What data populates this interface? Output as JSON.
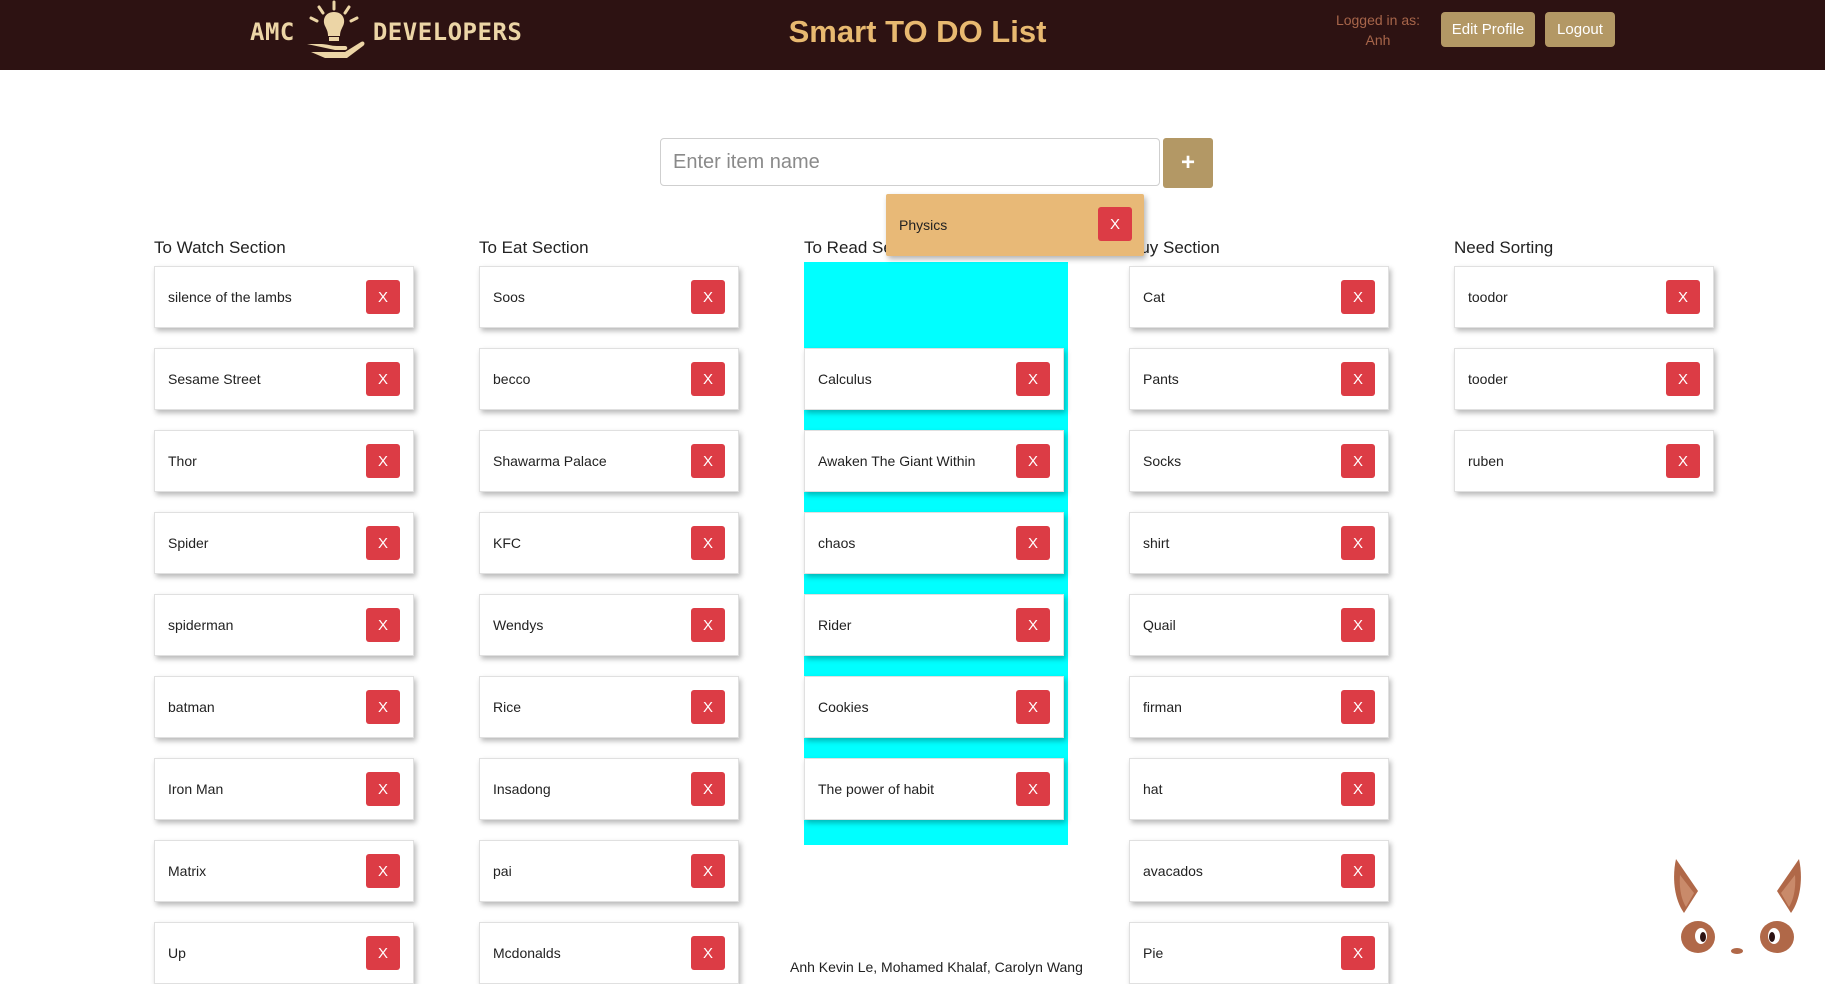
{
  "header": {
    "logo_left": "AMC",
    "logo_right": "DEVELOPERS",
    "title": "Smart TO DO List",
    "logged_in_label": "Logged in as:",
    "user": "Anh",
    "edit_profile": "Edit Profile",
    "logout": "Logout"
  },
  "add_item": {
    "placeholder": "Enter item name",
    "button": "+"
  },
  "dragging_item": {
    "label": "Physics",
    "delete": "X"
  },
  "delete_label": "X",
  "sections": [
    {
      "title": "To Watch Section",
      "items": [
        "silence of the lambs",
        "Sesame Street",
        "Thor",
        "Spider",
        "spiderman",
        "batman",
        "Iron Man",
        "Matrix",
        "Up"
      ]
    },
    {
      "title": "To Eat Section",
      "items": [
        "Soos",
        "becco",
        "Shawarma Palace",
        "KFC",
        "Wendys",
        "Rice",
        "Insadong",
        "pai",
        "Mcdonalds"
      ]
    },
    {
      "title": "To Read Se",
      "items": [
        "Calculus",
        "Awaken The Giant Within",
        "chaos",
        "Rider",
        "Cookies",
        "The power of habit"
      ]
    },
    {
      "title": "Buy Section",
      "items": [
        "Cat",
        "Pants",
        "Socks",
        "shirt",
        "Quail",
        "firman",
        "hat",
        "avacados",
        "Pie"
      ]
    },
    {
      "title": "Need Sorting",
      "items": [
        "toodor",
        "tooder",
        "ruben"
      ]
    }
  ],
  "footer": {
    "credits": "Anh Kevin Le, Mohamed Khalaf, Carolyn Wang"
  },
  "colors": {
    "header_bg": "#2d1212",
    "title": "#e8b970",
    "button": "#b39865",
    "delete": "#dc3c45",
    "dropzone": "#00ffff",
    "dragging_card": "#e8b977"
  }
}
